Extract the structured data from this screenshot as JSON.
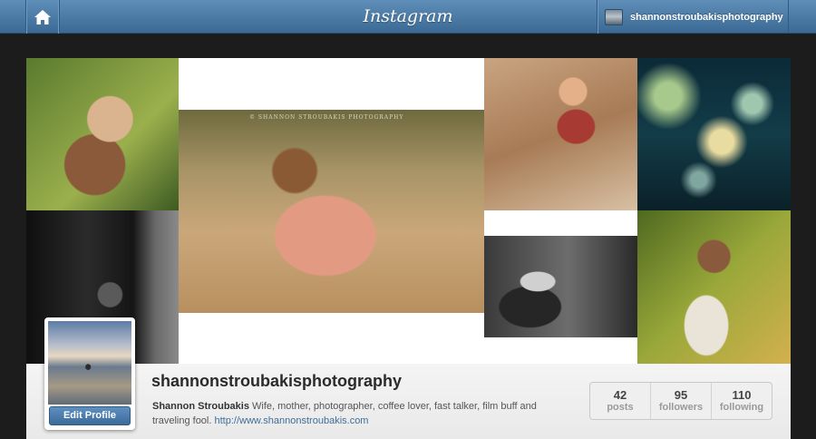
{
  "header": {
    "logo": "Instagram",
    "username": "shannonstroubakisphotography"
  },
  "icons": {
    "home": "home-icon"
  },
  "grid": {
    "watermark_main": "© SHANNON STROUBAKIS PHOTOGRAPHY",
    "watermark_small": "© SHANNON STROUBAKIS PHOTOGRAPHY"
  },
  "profile": {
    "username": "shannonstroubakisphotography",
    "full_name": "Shannon Stroubakis",
    "bio": "Wife, mother, photographer, coffee lover, fast talker, film buff and traveling fool.",
    "website": "http://www.shannonstroubakis.com",
    "edit_label": "Edit Profile"
  },
  "stats": [
    {
      "value": "42",
      "label": "posts"
    },
    {
      "value": "95",
      "label": "followers"
    },
    {
      "value": "110",
      "label": "following"
    }
  ],
  "colors": {
    "topbar": "#4a7aa5",
    "button": "#4a7cab",
    "link": "#3e6f9a"
  }
}
